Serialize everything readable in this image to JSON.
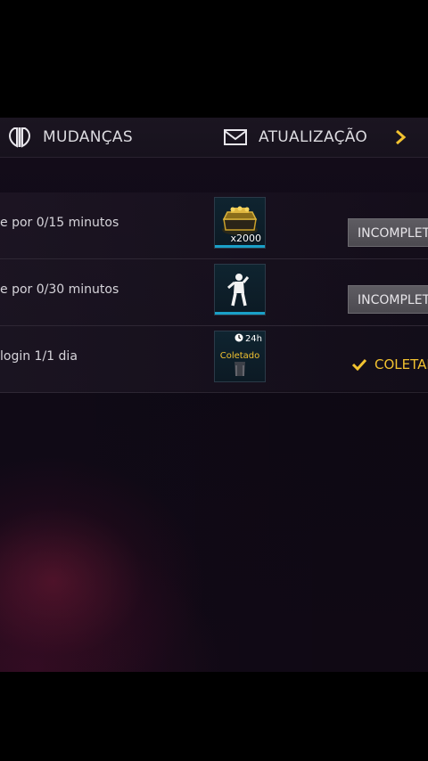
{
  "header": {
    "tabs": [
      {
        "label": "MUDANÇAS",
        "icon": "emblem-icon"
      },
      {
        "label": "ATUALIZAÇÃO",
        "icon": "envelope-icon"
      }
    ],
    "next_icon": "chevron-right-icon"
  },
  "missions": [
    {
      "text": "e por 0/15 minutos",
      "reward_icon": "gold-chest-icon",
      "reward_quantity": "x2000",
      "status": "INCOMPLETO"
    },
    {
      "text": "e por 0/30 minutos",
      "reward_icon": "emote-figure-icon",
      "status": "INCOMPLETO"
    },
    {
      "text": "login 1/1 dia",
      "reward_icon": "outfit-icon",
      "reward_timer": "24h",
      "reward_label": "Coletado",
      "status": "COLETADO"
    }
  ],
  "colors": {
    "accent_gold": "#f2c230",
    "progress_blue": "#1aa0c8",
    "button_gray": "#5e5c62"
  }
}
